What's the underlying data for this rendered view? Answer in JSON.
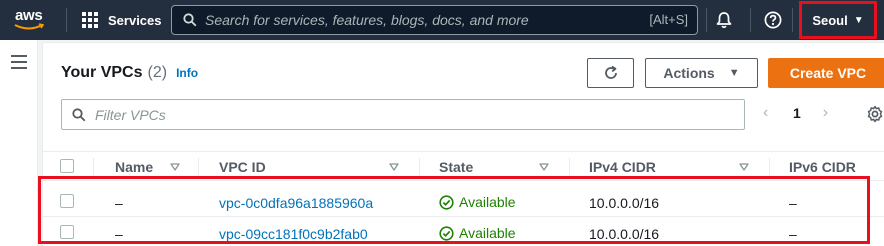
{
  "nav": {
    "logo_text": "aws",
    "services_label": "Services",
    "search_placeholder": "Search for services, features, blogs, docs, and more",
    "search_shortcut": "[Alt+S]",
    "region_label": "Seoul"
  },
  "page": {
    "title": "Your VPCs",
    "count": "(2)",
    "info_label": "Info",
    "actions_label": "Actions",
    "create_label": "Create VPC",
    "filter_placeholder": "Filter VPCs",
    "page_number": "1"
  },
  "table": {
    "columns": [
      "Name",
      "VPC ID",
      "State",
      "IPv4 CIDR",
      "IPv6 CIDR"
    ],
    "rows": [
      {
        "name": "–",
        "vpc_id": "vpc-0c0dfa96a1885960a",
        "state": "Available",
        "ipv4": "10.0.0.0/16",
        "ipv6": "–"
      },
      {
        "name": "–",
        "vpc_id": "vpc-09cc181f0c9b2fab0",
        "state": "Available",
        "ipv4": "10.0.0.0/16",
        "ipv6": "–"
      }
    ]
  },
  "colors": {
    "nav_bg": "#232f3e",
    "accent_orange": "#ec7211",
    "link_blue": "#0073bb",
    "status_green": "#1d8102",
    "highlight_red": "#e8101e"
  }
}
